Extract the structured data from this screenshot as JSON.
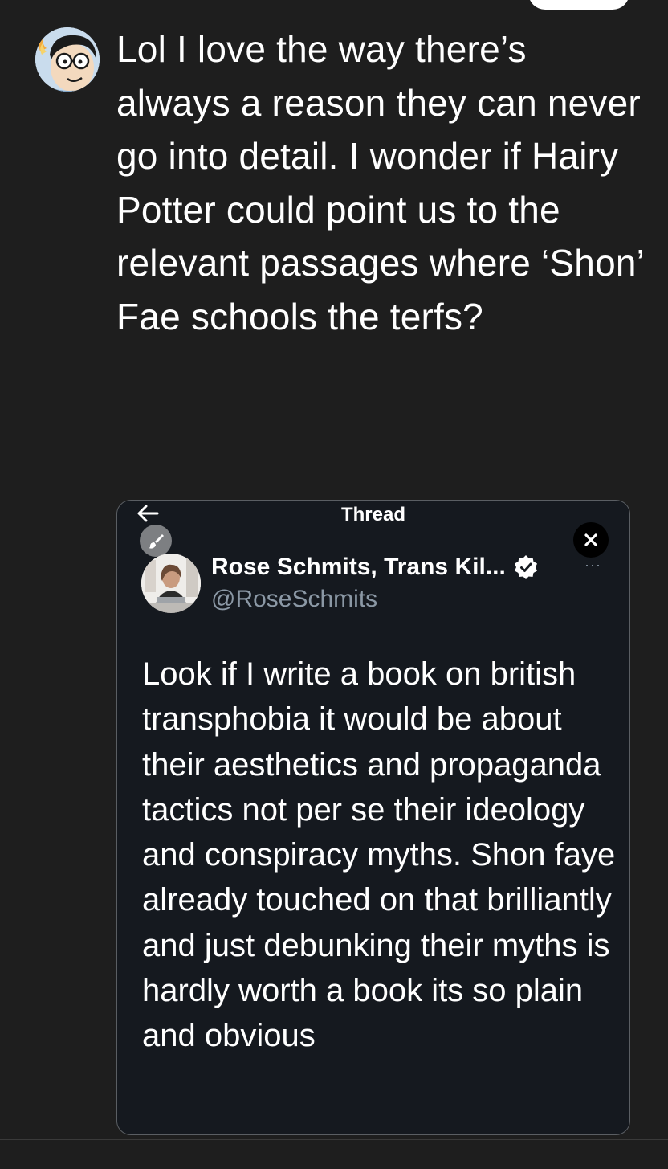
{
  "post": {
    "text": "Lol I love the way there’s always a reason they can never go into detail. I wonder if Hairy Potter could point us to the relevant passages where ‘Shon’ Fae schools the terfs?"
  },
  "quoted_view": {
    "title": "Thread",
    "author_name": "Rose Schmits, Trans Kil...",
    "author_handle": "@RoseSchmits",
    "more_label": "···",
    "body": "Look if I write a book on british transphobia it would be about their aesthetics and propaganda tactics not per se their ideology and conspiracy myths. Shon faye already touched on that brilliantly and just debunking their myths is hardly worth a book its so plain and obvious",
    "icons": {
      "back": "back-arrow-icon",
      "edit": "brush-icon",
      "close": "close-icon",
      "verified": "verified-badge-icon",
      "more": "more-icon"
    }
  },
  "colors": {
    "background": "#1e1e1e",
    "card_background": "#15191f",
    "card_border": "#5a5e63",
    "handle_gray": "#8b98a5",
    "text": "#ffffff"
  }
}
